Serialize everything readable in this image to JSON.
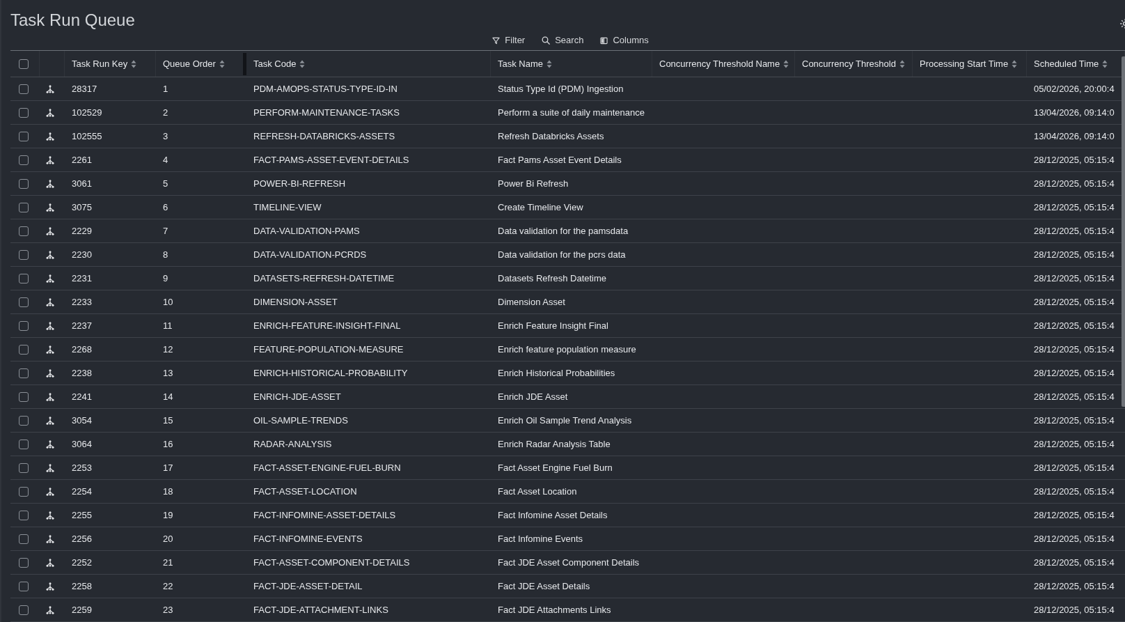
{
  "title": "Task Run Queue",
  "toolbar": [
    {
      "label": "Filter",
      "kind": "filter"
    },
    {
      "label": "Search",
      "kind": "search"
    },
    {
      "label": "Columns",
      "kind": "columns"
    }
  ],
  "table": {
    "select_all": {
      "checked": false
    },
    "columns": [
      {
        "label": "Task Run Key"
      },
      {
        "label": "Queue Order"
      },
      {
        "label": "Task Code"
      },
      {
        "label": "Task Name"
      },
      {
        "label": "Concurrency Threshold Name"
      },
      {
        "label": "Concurrency Threshold"
      },
      {
        "label": "Processing Start Time"
      },
      {
        "label": "Scheduled Time"
      }
    ],
    "rows": [
      {
        "checked": false,
        "task_run_key": "28317",
        "queue_order": "1",
        "task_code": "PDM-AMOPS-STATUS-TYPE-ID-IN",
        "task_name": "Status Type Id (PDM) Ingestion",
        "scheduled_time": "05/02/2026, 20:00:4"
      },
      {
        "checked": false,
        "task_run_key": "102529",
        "queue_order": "2",
        "task_code": "PERFORM-MAINTENANCE-TASKS",
        "task_name": "Perform a suite of daily maintenance",
        "scheduled_time": "13/04/2026, 09:14:0"
      },
      {
        "checked": false,
        "task_run_key": "102555",
        "queue_order": "3",
        "task_code": "REFRESH-DATABRICKS-ASSETS",
        "task_name": "Refresh Databricks Assets",
        "scheduled_time": "13/04/2026, 09:14:0"
      },
      {
        "checked": false,
        "task_run_key": "2261",
        "queue_order": "4",
        "task_code": "FACT-PAMS-ASSET-EVENT-DETAILS",
        "task_name": "Fact Pams Asset Event Details",
        "scheduled_time": "28/12/2025, 05:15:4"
      },
      {
        "checked": false,
        "task_run_key": "3061",
        "queue_order": "5",
        "task_code": "POWER-BI-REFRESH",
        "task_name": "Power Bi Refresh",
        "scheduled_time": "28/12/2025, 05:15:4"
      },
      {
        "checked": false,
        "task_run_key": "3075",
        "queue_order": "6",
        "task_code": "TIMELINE-VIEW",
        "task_name": "Create Timeline View",
        "scheduled_time": "28/12/2025, 05:15:4"
      },
      {
        "checked": false,
        "task_run_key": "2229",
        "queue_order": "7",
        "task_code": "DATA-VALIDATION-PAMS",
        "task_name": "Data validation for the pamsdata",
        "scheduled_time": "28/12/2025, 05:15:4"
      },
      {
        "checked": false,
        "task_run_key": "2230",
        "queue_order": "8",
        "task_code": "DATA-VALIDATION-PCRDS",
        "task_name": "Data validation for the pcrs data",
        "scheduled_time": "28/12/2025, 05:15:4"
      },
      {
        "checked": false,
        "task_run_key": "2231",
        "queue_order": "9",
        "task_code": "DATASETS-REFRESH-DATETIME",
        "task_name": "Datasets Refresh Datetime",
        "scheduled_time": "28/12/2025, 05:15:4"
      },
      {
        "checked": false,
        "task_run_key": "2233",
        "queue_order": "10",
        "task_code": "DIMENSION-ASSET",
        "task_name": "Dimension Asset",
        "scheduled_time": "28/12/2025, 05:15:4"
      },
      {
        "checked": false,
        "task_run_key": "2237",
        "queue_order": "11",
        "task_code": "ENRICH-FEATURE-INSIGHT-FINAL",
        "task_name": "Enrich Feature Insight Final",
        "scheduled_time": "28/12/2025, 05:15:4"
      },
      {
        "checked": false,
        "task_run_key": "2268",
        "queue_order": "12",
        "task_code": "FEATURE-POPULATION-MEASURE",
        "task_name": "Enrich feature population measure",
        "scheduled_time": "28/12/2025, 05:15:4"
      },
      {
        "checked": false,
        "task_run_key": "2238",
        "queue_order": "13",
        "task_code": "ENRICH-HISTORICAL-PROBABILITY",
        "task_name": "Enrich Historical Probabilities",
        "scheduled_time": "28/12/2025, 05:15:4"
      },
      {
        "checked": false,
        "task_run_key": "2241",
        "queue_order": "14",
        "task_code": "ENRICH-JDE-ASSET",
        "task_name": "Enrich JDE Asset",
        "scheduled_time": "28/12/2025, 05:15:4"
      },
      {
        "checked": false,
        "task_run_key": "3054",
        "queue_order": "15",
        "task_code": "OIL-SAMPLE-TRENDS",
        "task_name": "Enrich Oil Sample Trend Analysis",
        "scheduled_time": "28/12/2025, 05:15:4"
      },
      {
        "checked": false,
        "task_run_key": "3064",
        "queue_order": "16",
        "task_code": "RADAR-ANALYSIS",
        "task_name": "Enrich Radar Analysis Table",
        "scheduled_time": "28/12/2025, 05:15:4"
      },
      {
        "checked": false,
        "task_run_key": "2253",
        "queue_order": "17",
        "task_code": "FACT-ASSET-ENGINE-FUEL-BURN",
        "task_name": "Fact Asset Engine Fuel Burn",
        "scheduled_time": "28/12/2025, 05:15:4"
      },
      {
        "checked": false,
        "task_run_key": "2254",
        "queue_order": "18",
        "task_code": "FACT-ASSET-LOCATION",
        "task_name": "Fact Asset Location",
        "scheduled_time": "28/12/2025, 05:15:4"
      },
      {
        "checked": false,
        "task_run_key": "2255",
        "queue_order": "19",
        "task_code": "FACT-INFOMINE-ASSET-DETAILS",
        "task_name": "Fact Infomine Asset Details",
        "scheduled_time": "28/12/2025, 05:15:4"
      },
      {
        "checked": false,
        "task_run_key": "2256",
        "queue_order": "20",
        "task_code": "FACT-INFOMINE-EVENTS",
        "task_name": "Fact Infomine Events",
        "scheduled_time": "28/12/2025, 05:15:4"
      },
      {
        "checked": false,
        "task_run_key": "2252",
        "queue_order": "21",
        "task_code": "FACT-ASSET-COMPONENT-DETAILS",
        "task_name": "Fact JDE Asset Component Details",
        "scheduled_time": "28/12/2025, 05:15:4"
      },
      {
        "checked": false,
        "task_run_key": "2258",
        "queue_order": "22",
        "task_code": "FACT-JDE-ASSET-DETAIL",
        "task_name": "Fact JDE Asset Details",
        "scheduled_time": "28/12/2025, 05:15:4"
      },
      {
        "checked": false,
        "task_run_key": "2259",
        "queue_order": "23",
        "task_code": "FACT-JDE-ATTACHMENT-LINKS",
        "task_name": "Fact JDE Attachments Links",
        "scheduled_time": "28/12/2025, 05:15:4"
      }
    ]
  }
}
